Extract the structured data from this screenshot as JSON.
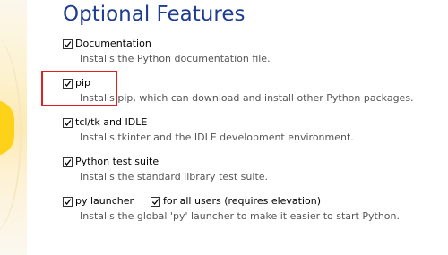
{
  "title": "Optional Features",
  "options": [
    {
      "label": "Documentation",
      "checked": true,
      "description": "Installs the Python documentation file."
    },
    {
      "label": "pip",
      "checked": true,
      "description": "Installs pip, which can download and install other Python packages."
    },
    {
      "label": "tcl/tk and IDLE",
      "checked": true,
      "description": "Installs tkinter and the IDLE development environment."
    },
    {
      "label": "Python test suite",
      "checked": true,
      "description": "Installs the standard library test suite."
    },
    {
      "label": "py launcher",
      "checked": true,
      "description": "Installs the global 'py' launcher to make it easier to start Python."
    }
  ],
  "for_all_users": {
    "label": "for all users (requires elevation)",
    "checked": true
  },
  "colors": {
    "title": "#1f3d8f",
    "highlight": "#e0201f",
    "description": "#555555"
  },
  "icons": {
    "checkbox": "checkmark-icon"
  }
}
